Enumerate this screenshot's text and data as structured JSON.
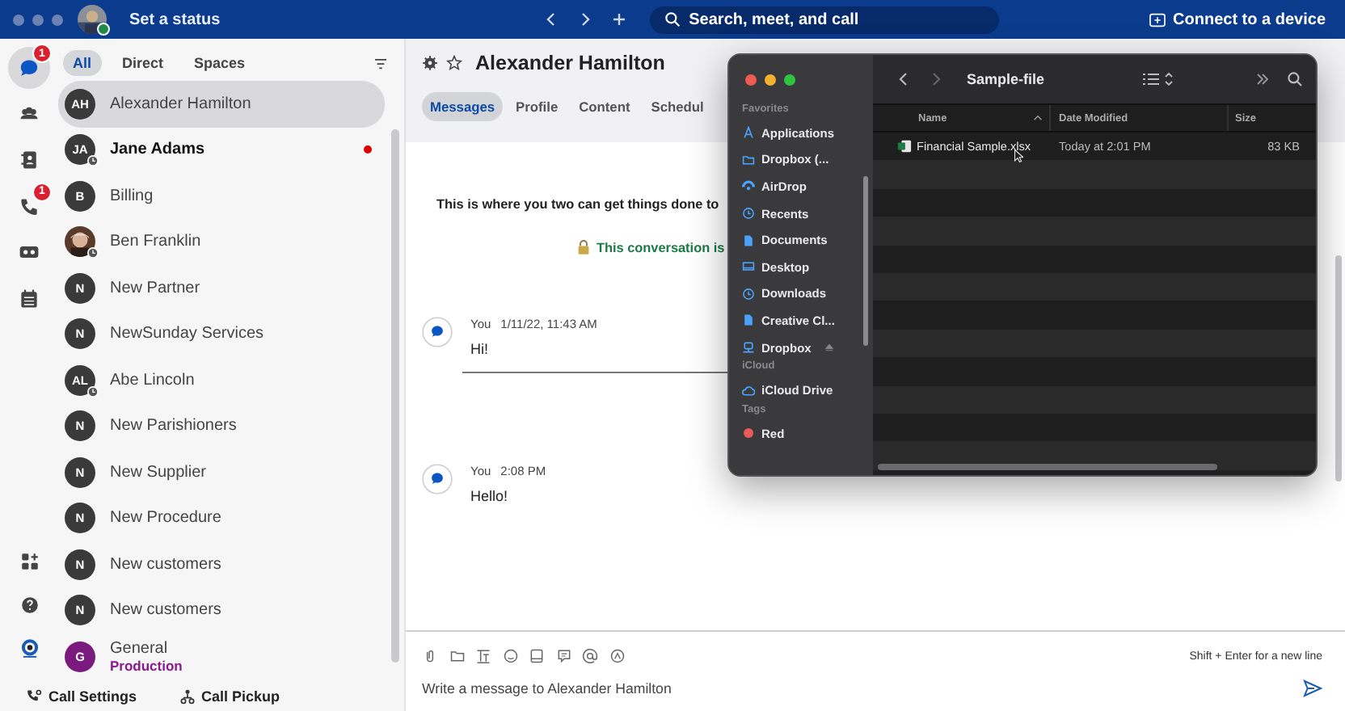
{
  "topbar": {
    "status": "Set a status",
    "search": "Search, meet, and call",
    "connect": "Connect to a device"
  },
  "rail": [
    {
      "badge": "1",
      "selected": true
    },
    {
      "selected": false
    },
    {
      "selected": false
    },
    {
      "badge": "1",
      "selected": false
    },
    {
      "selected": false
    },
    {
      "selected": false
    }
  ],
  "filters": [
    {
      "label": "All",
      "selected": true
    },
    {
      "label": "Direct",
      "selected": false
    },
    {
      "label": "Spaces",
      "selected": false
    }
  ],
  "contacts": [
    {
      "kind": "initials",
      "initials": "AH",
      "name": "Alexander Hamilton",
      "selected": true,
      "unread": false,
      "away": false,
      "color": "#3a3a3a"
    },
    {
      "kind": "initials",
      "initials": "JA",
      "name": "Jane Adams",
      "selected": false,
      "unread": true,
      "away": true,
      "color": "#3a3a3a"
    },
    {
      "kind": "initials",
      "initials": "B",
      "name": "Billing",
      "selected": false,
      "unread": false,
      "away": false,
      "color": "#3a3a3a"
    },
    {
      "kind": "picture",
      "name": "Ben Franklin",
      "selected": false,
      "unread": false,
      "away": true
    },
    {
      "kind": "initials",
      "initials": "N",
      "name": "New Partner",
      "selected": false,
      "unread": false,
      "away": false,
      "color": "#3a3a3a"
    },
    {
      "kind": "initials",
      "initials": "N",
      "name": "NewSunday Services",
      "selected": false,
      "unread": false,
      "away": false,
      "color": "#3a3a3a"
    },
    {
      "kind": "initials",
      "initials": "AL",
      "name": "Abe Lincoln",
      "selected": false,
      "unread": false,
      "away": true,
      "color": "#3a3a3a"
    },
    {
      "kind": "initials",
      "initials": "N",
      "name": "New Parishioners",
      "selected": false,
      "unread": false,
      "away": false,
      "color": "#3a3a3a"
    },
    {
      "kind": "initials",
      "initials": "N",
      "name": "New Supplier",
      "selected": false,
      "unread": false,
      "away": false,
      "color": "#3a3a3a"
    },
    {
      "kind": "initials",
      "initials": "N",
      "name": "New Procedure",
      "selected": false,
      "unread": false,
      "away": false,
      "color": "#3a3a3a"
    },
    {
      "kind": "initials",
      "initials": "N",
      "name": "New customers",
      "selected": false,
      "unread": false,
      "away": false,
      "color": "#3a3a3a"
    },
    {
      "kind": "initials",
      "initials": "N",
      "name": "New customers",
      "selected": false,
      "unread": false,
      "away": false,
      "color": "#3a3a3a"
    },
    {
      "kind": "initials",
      "initials": "G",
      "name": "General",
      "subtitle": "Production",
      "selected": false,
      "unread": false,
      "away": false,
      "color": "#7a1a7e"
    }
  ],
  "footer": [
    "Call Settings",
    "Call Pickup"
  ],
  "conversation": {
    "title": "Alexander Hamilton",
    "tabs": [
      {
        "label": "Messages",
        "selected": true
      },
      {
        "label": "Profile",
        "selected": false
      },
      {
        "label": "Content",
        "selected": false
      },
      {
        "label": "Schedul",
        "selected": false
      }
    ],
    "intro": "This is where you two can get things done to",
    "secure": "This conversation is",
    "messages": [
      {
        "author": "You",
        "time": "1/11/22, 11:43 AM",
        "text": "Hi!"
      },
      {
        "author": "You",
        "time": "2:08 PM",
        "text": "Hello!"
      }
    ],
    "hint": "Shift + Enter for a new line",
    "placeholder": "Write a message to Alexander Hamilton"
  },
  "finder": {
    "title": "Sample-file",
    "sections": [
      {
        "heading": "Favorites",
        "items": [
          {
            "label": "Applications"
          },
          {
            "label": "Dropbox (..."
          },
          {
            "label": "AirDrop"
          },
          {
            "label": "Recents"
          },
          {
            "label": "Documents"
          },
          {
            "label": "Desktop"
          },
          {
            "label": "Downloads"
          },
          {
            "label": "Creative Cl..."
          },
          {
            "label": "Dropbox"
          }
        ]
      },
      {
        "heading": "iCloud",
        "items": [
          {
            "label": "iCloud Drive"
          }
        ]
      },
      {
        "heading": "Tags",
        "items": [
          {
            "label": "Red",
            "color": "#e85c5c"
          }
        ]
      }
    ],
    "columns": [
      "Name",
      "Date Modified",
      "Size"
    ],
    "files": [
      {
        "name": "Financial Sample.xlsx",
        "modified": "Today at 2:01 PM",
        "size": "83 KB"
      }
    ]
  }
}
